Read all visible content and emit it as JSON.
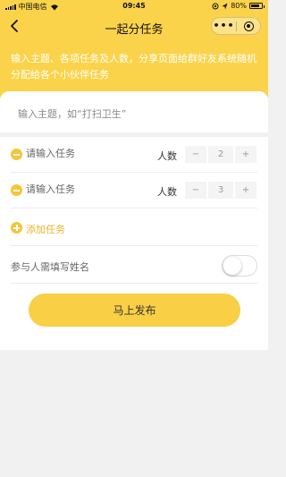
{
  "status_bar": {
    "carrier": "中国电信",
    "time": "09:45",
    "battery": "80%",
    "battery_level": 0.8
  },
  "nav": {
    "title": "一起分任务",
    "more_label": "•••",
    "back_icon": "chevron-left-icon",
    "close_icon": "target-circle-icon"
  },
  "banner": {
    "text": "输入主题、各项任务及人数，分享页面给群好友系统随机分配给各个小伙伴任务"
  },
  "topic": {
    "placeholder": "输入主题，如“打扫卫生”"
  },
  "tasks": [
    {
      "placeholder": "请输入任务",
      "count_label": "人数",
      "count": "2",
      "minus": "−",
      "plus": "+"
    },
    {
      "placeholder": "请输入任务",
      "count_label": "人数",
      "count": "3",
      "minus": "−",
      "plus": "+"
    }
  ],
  "add_task": {
    "label": "添加任务"
  },
  "require_name": {
    "label": "参与人需填写姓名",
    "enabled": false
  },
  "publish": {
    "label": "马上发布"
  },
  "colors": {
    "accent": "#fad34a",
    "button": "#f8cf45",
    "link": "#f0b12b",
    "background": "#f1f1f1"
  }
}
